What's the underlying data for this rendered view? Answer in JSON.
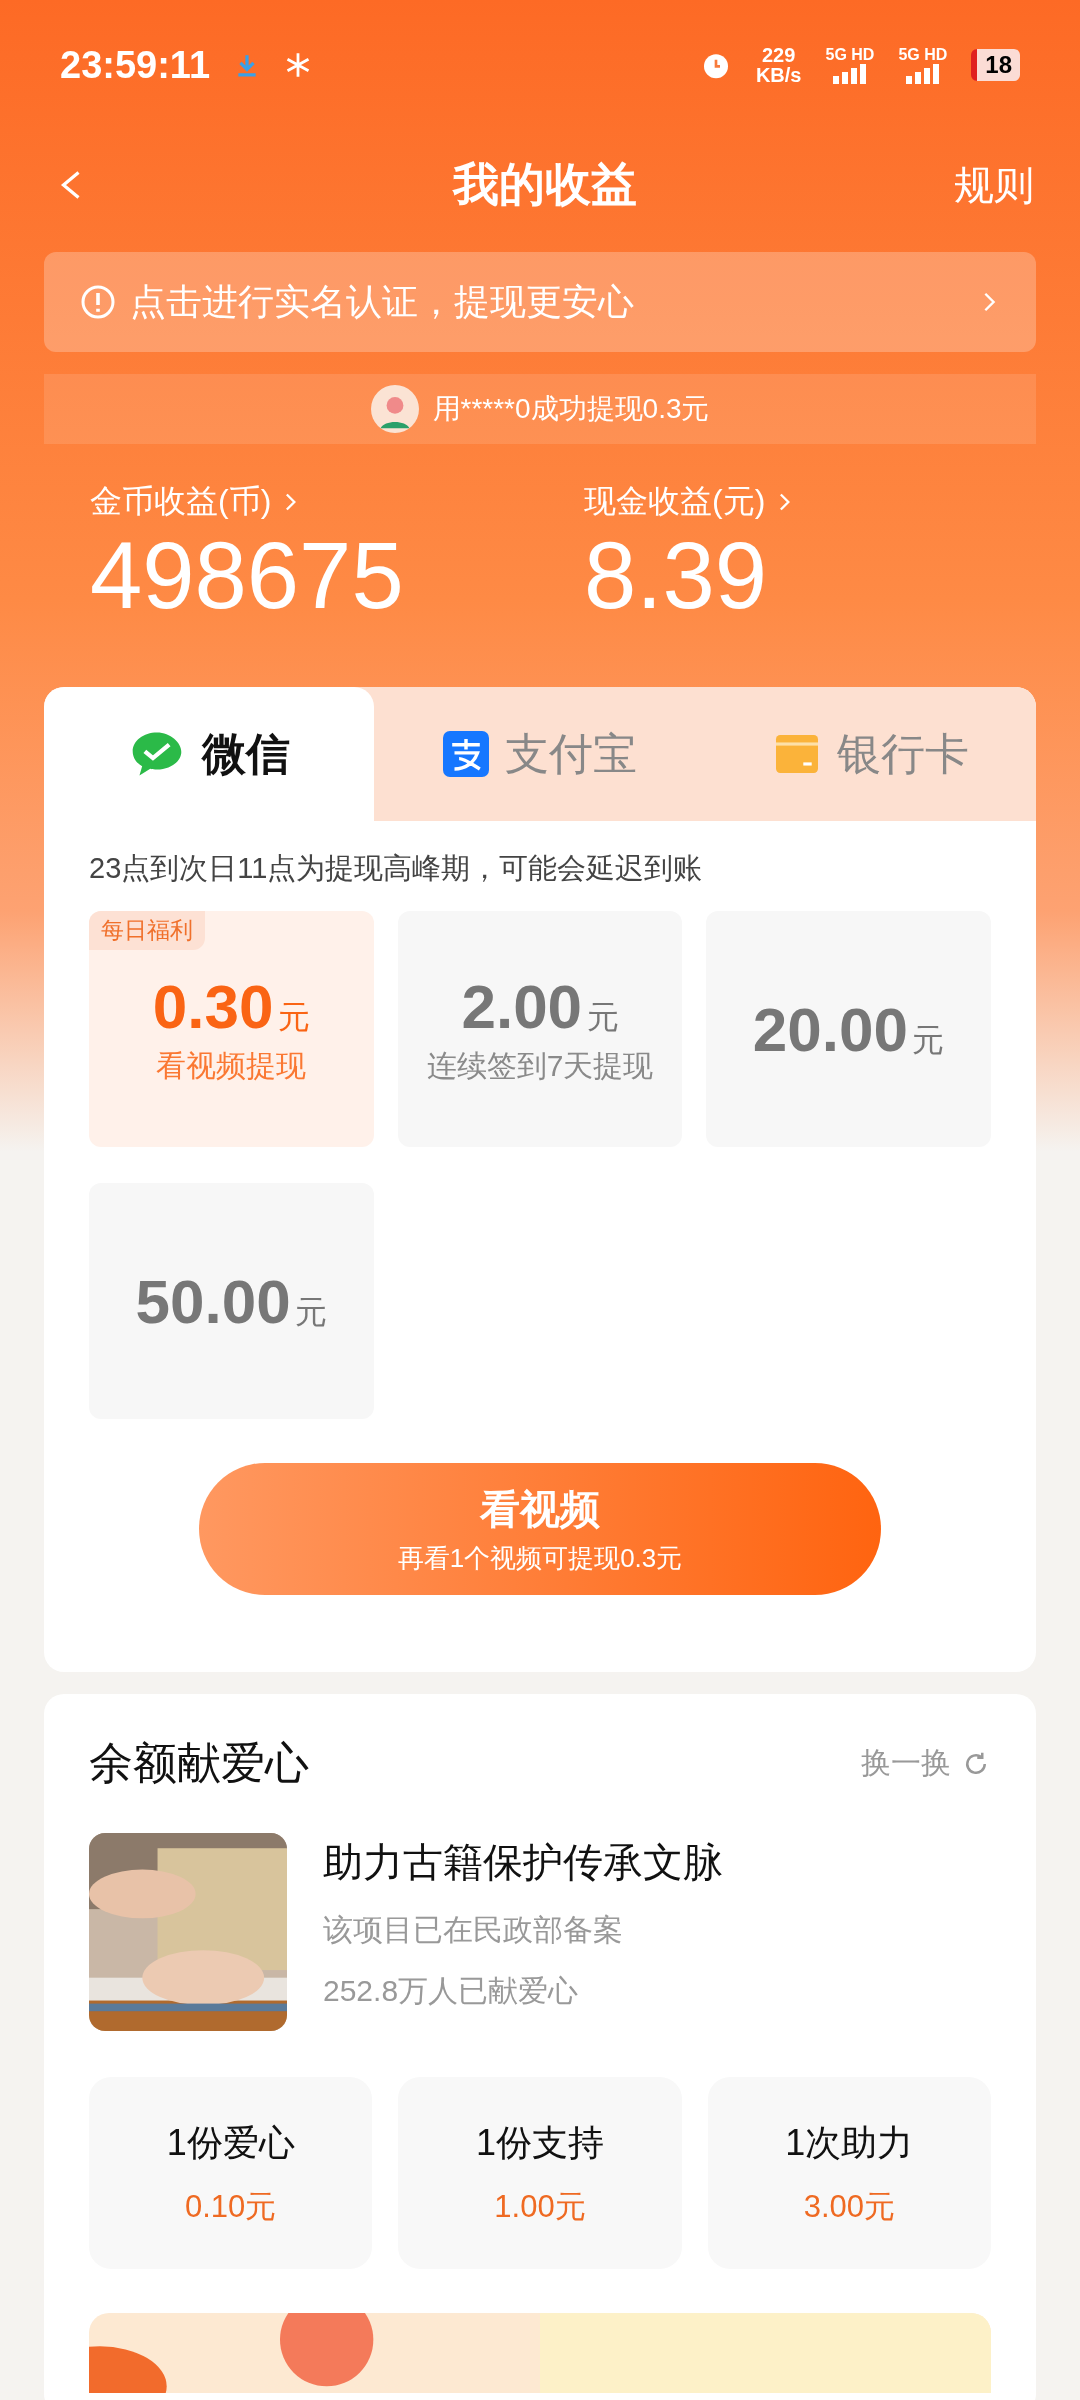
{
  "status_bar": {
    "time": "23:59:11",
    "speed_value": "229",
    "speed_unit": "KB/s",
    "networks": [
      "5G HD",
      "5G HD"
    ],
    "battery": "18"
  },
  "header": {
    "title": "我的收益",
    "rules": "规则"
  },
  "notice": {
    "text": "点击进行实名认证，提现更安心"
  },
  "ticker": {
    "text": "用*****0成功提现0.3元"
  },
  "balances": [
    {
      "label": "金币收益(币)",
      "value": "498675"
    },
    {
      "label": "现金收益(元)",
      "value": "8.39"
    }
  ],
  "tabs": [
    {
      "label": "微信",
      "kind": "wechat",
      "selected": true
    },
    {
      "label": "支付宝",
      "kind": "alipay",
      "selected": false
    },
    {
      "label": "银行卡",
      "kind": "card",
      "selected": false
    }
  ],
  "peak_notice": "23点到次日11点为提现高峰期，可能会延迟到账",
  "options": [
    {
      "amount": "0.30",
      "unit": "元",
      "badge": "每日福利",
      "subtitle": "看视频提现",
      "selected": true
    },
    {
      "amount": "2.00",
      "unit": "元",
      "subtitle": "连续签到7天提现",
      "selected": false
    },
    {
      "amount": "20.00",
      "unit": "元",
      "selected": false
    },
    {
      "amount": "50.00",
      "unit": "元",
      "selected": false
    }
  ],
  "action_button": {
    "title": "看视频",
    "subtitle": "再看1个视频可提现0.3元"
  },
  "charity": {
    "title": "余额献爱心",
    "refresh": "换一换",
    "project_title": "助力古籍保护传承文脉",
    "project_note": "该项目已在民政部备案",
    "supporters": "252.8万人已献爱心",
    "donations": [
      {
        "label": "1份爱心",
        "amount": "0.10元"
      },
      {
        "label": "1份支持",
        "amount": "1.00元"
      },
      {
        "label": "1次助力",
        "amount": "3.00元"
      }
    ]
  }
}
